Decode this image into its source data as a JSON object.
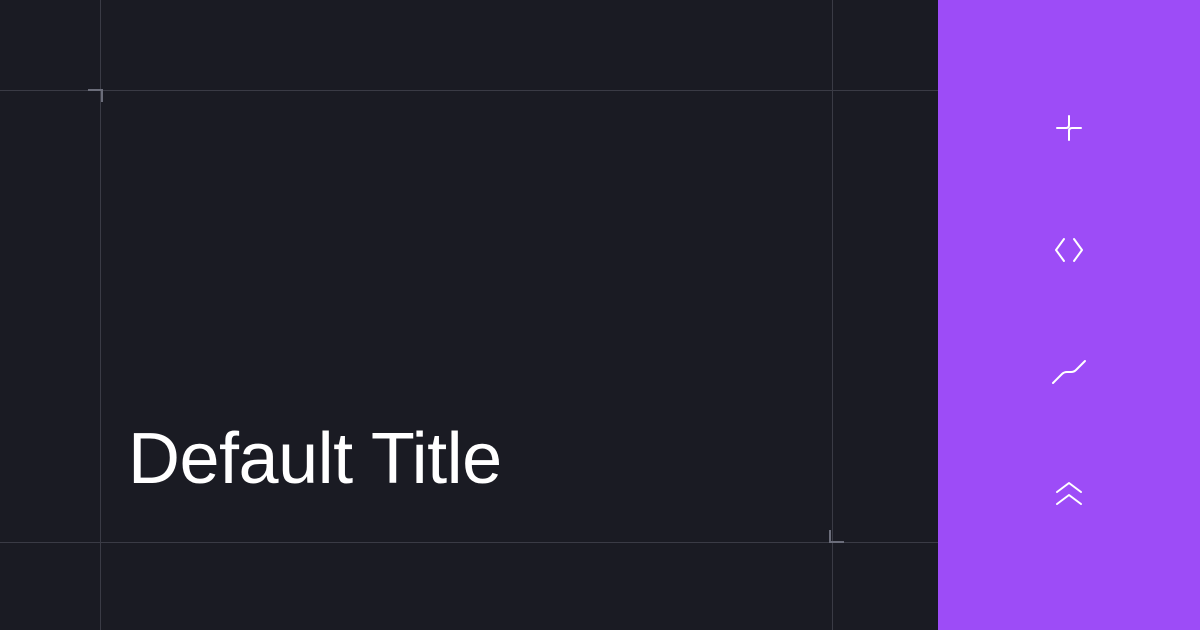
{
  "main": {
    "title": "Default Title"
  },
  "sidebar": {
    "icons": [
      "crosshair-icon",
      "brackets-icon",
      "slashes-icon",
      "double-chevron-up-icon"
    ]
  },
  "colors": {
    "background": "#1a1b23",
    "accent": "#9d4cf7",
    "text": "#ffffff",
    "guide": "#3a3b45"
  }
}
